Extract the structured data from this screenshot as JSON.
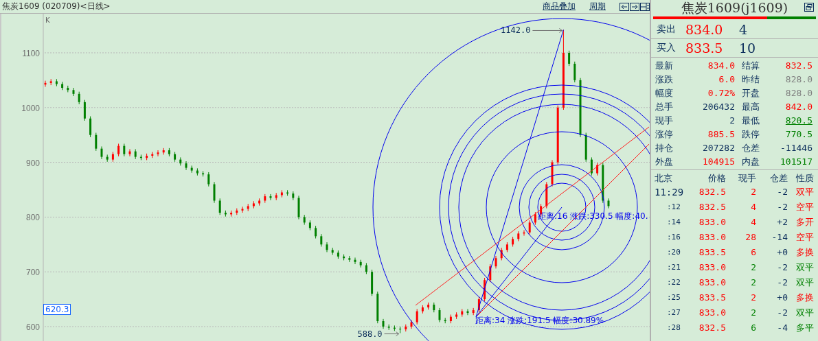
{
  "top_bar": {
    "title": "焦炭1609 (020709)<日线>",
    "links": [
      "商品叠加",
      "周期"
    ]
  },
  "chart": {
    "cursor_value": "620.3",
    "high_label": "1142.0",
    "low_label": "588.0",
    "measurements": [
      "距离:16  涨跌:330.5  幅度:40.",
      "距离:34  涨跌:191.5  幅度:30.89%"
    ],
    "chart_data": {
      "type": "candlestick",
      "title": "K",
      "grid": true,
      "ylim": [
        573.7,
        1171.4
      ],
      "yticks": [
        600,
        700,
        800,
        900,
        1000,
        1100
      ],
      "ohlc": [
        [
          1042,
          1049,
          1038,
          1045
        ],
        [
          1045,
          1052,
          1041,
          1048
        ],
        [
          1048,
          1052,
          1039,
          1043
        ],
        [
          1043,
          1047,
          1032,
          1036
        ],
        [
          1036,
          1040,
          1028,
          1032
        ],
        [
          1032,
          1036,
          1021,
          1025
        ],
        [
          1025,
          1029,
          1006,
          1010
        ],
        [
          1010,
          1014,
          976,
          980
        ],
        [
          980,
          984,
          946,
          950
        ],
        [
          950,
          954,
          921,
          925
        ],
        [
          925,
          929,
          906,
          910
        ],
        [
          910,
          914,
          901,
          905
        ],
        [
          905,
          919,
          901,
          915
        ],
        [
          915,
          934,
          911,
          930
        ],
        [
          930,
          934,
          911,
          915
        ],
        [
          915,
          924,
          911,
          920
        ],
        [
          920,
          924,
          906,
          910
        ],
        [
          910,
          914,
          904,
          908
        ],
        [
          908,
          916,
          904,
          912
        ],
        [
          912,
          919,
          908,
          915
        ],
        [
          915,
          922,
          911,
          918
        ],
        [
          918,
          926,
          914,
          922
        ],
        [
          922,
          926,
          911,
          915
        ],
        [
          915,
          919,
          901,
          905
        ],
        [
          905,
          909,
          894,
          898
        ],
        [
          898,
          902,
          886,
          890
        ],
        [
          890,
          894,
          881,
          885
        ],
        [
          885,
          889,
          876,
          880
        ],
        [
          880,
          884,
          874,
          878
        ],
        [
          878,
          882,
          856,
          860
        ],
        [
          860,
          864,
          826,
          830
        ],
        [
          830,
          834,
          804,
          808
        ],
        [
          808,
          812,
          801,
          805
        ],
        [
          805,
          812,
          801,
          808
        ],
        [
          808,
          816,
          804,
          812
        ],
        [
          812,
          819,
          808,
          815
        ],
        [
          815,
          824,
          811,
          820
        ],
        [
          820,
          829,
          816,
          825
        ],
        [
          825,
          834,
          821,
          830
        ],
        [
          830,
          842,
          826,
          838
        ],
        [
          838,
          842,
          831,
          835
        ],
        [
          835,
          844,
          831,
          840
        ],
        [
          840,
          849,
          836,
          845
        ],
        [
          845,
          849,
          839,
          843
        ],
        [
          843,
          847,
          831,
          835
        ],
        [
          835,
          839,
          796,
          800
        ],
        [
          800,
          804,
          786,
          790
        ],
        [
          790,
          794,
          776,
          780
        ],
        [
          780,
          784,
          761,
          765
        ],
        [
          765,
          769,
          746,
          750
        ],
        [
          750,
          754,
          736,
          740
        ],
        [
          740,
          744,
          731,
          735
        ],
        [
          735,
          739,
          724,
          728
        ],
        [
          728,
          732,
          721,
          725
        ],
        [
          725,
          729,
          718,
          722
        ],
        [
          722,
          726,
          714,
          718
        ],
        [
          718,
          722,
          708,
          712
        ],
        [
          712,
          716,
          696,
          700
        ],
        [
          700,
          704,
          656,
          660
        ],
        [
          660,
          664,
          606,
          610
        ],
        [
          610,
          614,
          596,
          600
        ],
        [
          600,
          604,
          594,
          598
        ],
        [
          598,
          602,
          592,
          596
        ],
        [
          596,
          600,
          588,
          595
        ],
        [
          595,
          604,
          591,
          600
        ],
        [
          600,
          612,
          596,
          608
        ],
        [
          608,
          632,
          604,
          628
        ],
        [
          628,
          639,
          624,
          635
        ],
        [
          635,
          644,
          631,
          640
        ],
        [
          640,
          644,
          626,
          630
        ],
        [
          630,
          634,
          608,
          612
        ],
        [
          612,
          616,
          606,
          610
        ],
        [
          610,
          622,
          606,
          618
        ],
        [
          618,
          626,
          614,
          622
        ],
        [
          622,
          632,
          618,
          628
        ],
        [
          628,
          632,
          621,
          625
        ],
        [
          625,
          634,
          621,
          630
        ],
        [
          630,
          654,
          626,
          650
        ],
        [
          650,
          689,
          646,
          685
        ],
        [
          685,
          714,
          681,
          710
        ],
        [
          710,
          729,
          706,
          725
        ],
        [
          725,
          744,
          721,
          740
        ],
        [
          740,
          754,
          736,
          750
        ],
        [
          750,
          764,
          746,
          760
        ],
        [
          760,
          774,
          756,
          770
        ],
        [
          770,
          776,
          766,
          772
        ],
        [
          772,
          794,
          768,
          790
        ],
        [
          790,
          809,
          786,
          805
        ],
        [
          805,
          824,
          801,
          820
        ],
        [
          820,
          864,
          816,
          860
        ],
        [
          860,
          904,
          856,
          900
        ],
        [
          900,
          1004,
          896,
          1000
        ],
        [
          1000,
          1142,
          996,
          1100
        ],
        [
          1100,
          1104,
          1076,
          1080
        ],
        [
          1080,
          1084,
          1046,
          1050
        ],
        [
          1050,
          1054,
          946,
          950
        ],
        [
          950,
          954,
          901,
          905
        ],
        [
          905,
          909,
          876,
          880
        ],
        [
          880,
          899,
          876,
          895
        ],
        [
          895,
          899,
          826,
          830
        ],
        [
          830,
          834,
          816,
          820
        ]
      ]
    }
  },
  "quote": {
    "title": "焦炭1609(j1609)",
    "buy_sell_bar": {
      "level": 0.7
    },
    "orders": [
      {
        "label": "卖出",
        "price": "834.0",
        "volume": "4"
      },
      {
        "label": "买入",
        "price": "833.5",
        "volume": "10"
      }
    ],
    "stats": [
      {
        "label": "最新",
        "value": "834.0",
        "color": "#ff0000"
      },
      {
        "label": "结算",
        "value": "832.5",
        "color": "#ff0000"
      },
      {
        "label": "涨跌",
        "value": "6.0",
        "color": "#ff0000"
      },
      {
        "label": "昨结",
        "value": "828.0",
        "color": "#808080"
      },
      {
        "label": "幅度",
        "value": "0.72%",
        "color": "#ff0000"
      },
      {
        "label": "开盘",
        "value": "828.0",
        "color": "#808080"
      },
      {
        "label": "总手",
        "value": "206432",
        "color": "#0a2c5a"
      },
      {
        "label": "最高",
        "value": "842.0",
        "color": "#ff0000"
      },
      {
        "label": "现手",
        "value": "2",
        "color": "#0a2c5a"
      },
      {
        "label": "最低",
        "value": "820.5",
        "color": "#008000",
        "underlined": true
      },
      {
        "label": "涨停",
        "value": "885.5",
        "color": "#ff0000"
      },
      {
        "label": "跌停",
        "value": "770.5",
        "color": "#008000"
      },
      {
        "label": "持仓",
        "value": "207282",
        "color": "#0a2c5a"
      },
      {
        "label": "仓差",
        "value": "-11446",
        "color": "#0a2c5a"
      },
      {
        "label": "外盘",
        "value": "104915",
        "color": "#ff0000"
      },
      {
        "label": "内盘",
        "value": "101517",
        "color": "#008000"
      }
    ],
    "ticks": {
      "columns": [
        "北京",
        "价格",
        "现手",
        "仓差",
        "性质"
      ],
      "rows": [
        {
          "time": "11:29",
          "price": "832.5",
          "volume": "2",
          "oi_change": "-2",
          "nature": "双平",
          "color": "#ff0000"
        },
        {
          "time": ":12",
          "price": "832.5",
          "volume": "4",
          "oi_change": "-2",
          "nature": "空平",
          "color": "#ff0000"
        },
        {
          "time": ":14",
          "price": "833.0",
          "volume": "4",
          "oi_change": "+2",
          "nature": "多开",
          "color": "#ff0000"
        },
        {
          "time": ":16",
          "price": "833.0",
          "volume": "28",
          "oi_change": "-14",
          "nature": "空平",
          "color": "#ff0000"
        },
        {
          "time": ":20",
          "price": "833.5",
          "volume": "6",
          "oi_change": "+0",
          "nature": "多换",
          "color": "#ff0000"
        },
        {
          "time": ":21",
          "price": "833.0",
          "volume": "2",
          "oi_change": "-2",
          "nature": "双平",
          "color": "#008000"
        },
        {
          "time": ":22",
          "price": "833.0",
          "volume": "2",
          "oi_change": "-2",
          "nature": "双平",
          "color": "#008000"
        },
        {
          "time": ":25",
          "price": "833.5",
          "volume": "2",
          "oi_change": "+0",
          "nature": "多换",
          "color": "#ff0000"
        },
        {
          "time": ":27",
          "price": "833.0",
          "volume": "2",
          "oi_change": "-2",
          "nature": "双平",
          "color": "#008000"
        },
        {
          "time": ":28",
          "price": "832.5",
          "volume": "6",
          "oi_change": "-4",
          "nature": "多平",
          "color": "#008000"
        }
      ]
    }
  }
}
